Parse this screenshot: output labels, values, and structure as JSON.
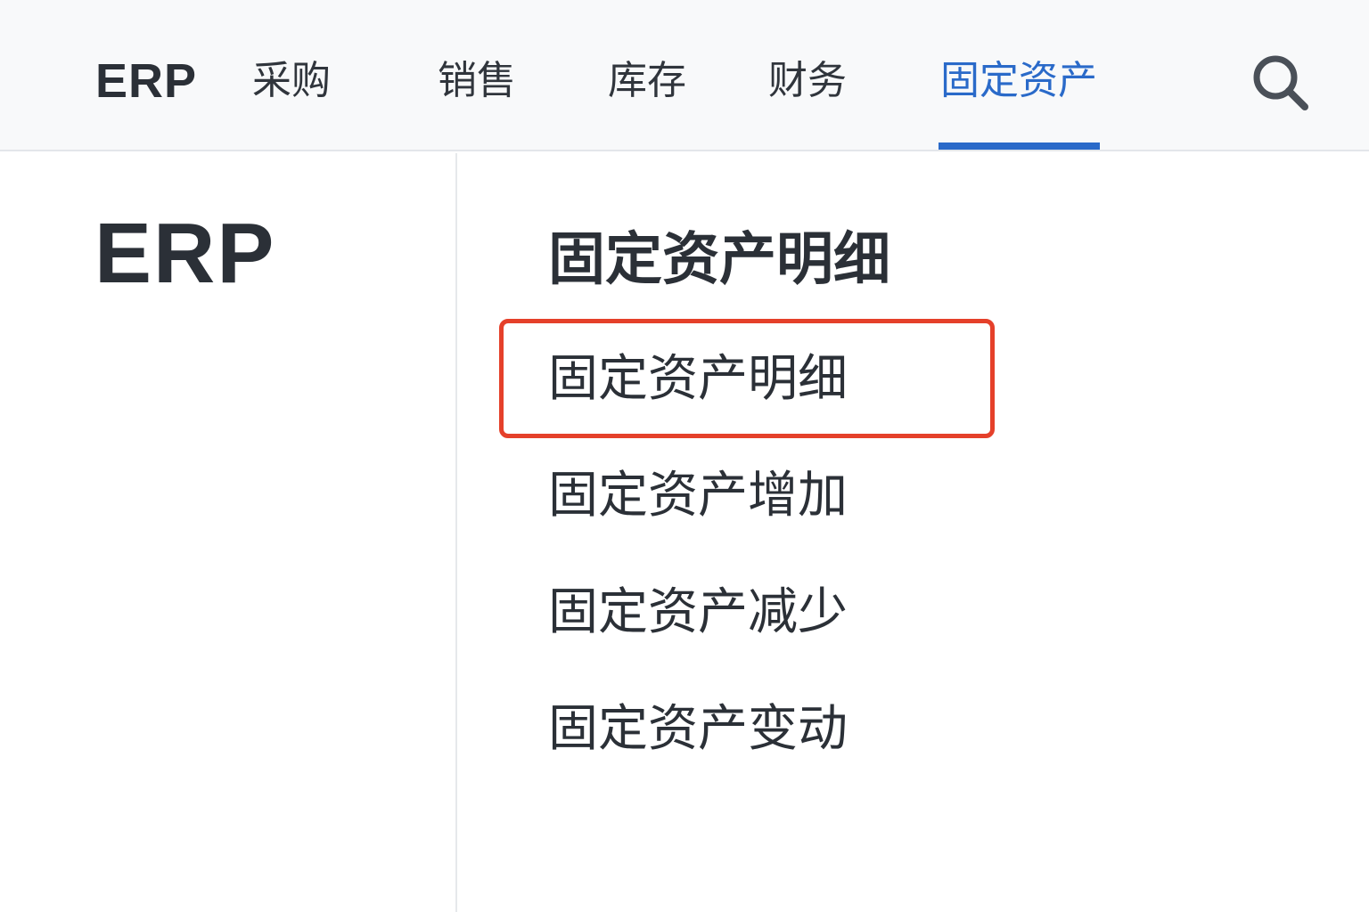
{
  "header": {
    "brand": "ERP",
    "tabs": [
      {
        "label": "采购"
      },
      {
        "label": "销售"
      },
      {
        "label": "库存"
      },
      {
        "label": "财务"
      },
      {
        "label": "固定资产"
      }
    ],
    "active_tab": "固定资产",
    "search_icon": "search-icon"
  },
  "sidebar": {
    "logo": "ERP"
  },
  "main": {
    "section_title": "固定资产明细",
    "menu": [
      {
        "label": "固定资产明细",
        "highlighted": true
      },
      {
        "label": "固定资产增加"
      },
      {
        "label": "固定资产减少"
      },
      {
        "label": "固定资产变动"
      }
    ]
  },
  "colors": {
    "accent": "#2a6ac9",
    "highlight": "#e5402a",
    "text": "#2b3037",
    "topbar_bg": "#f8f9fa"
  }
}
